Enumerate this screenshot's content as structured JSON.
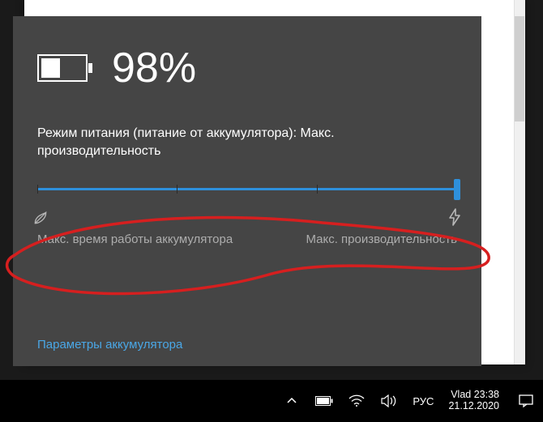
{
  "battery": {
    "percent": "98%",
    "mode_label": "Режим питания (питание от аккумулятора): Макс. производительность",
    "slider": {
      "left_label": "Макс. время работы аккумулятора",
      "right_label": "Макс. производительность",
      "value": 100
    },
    "settings_link": "Параметры аккумулятора"
  },
  "taskbar": {
    "lang": "РУС",
    "user": "Vlad",
    "time": "23:38",
    "date": "21.12.2020"
  }
}
